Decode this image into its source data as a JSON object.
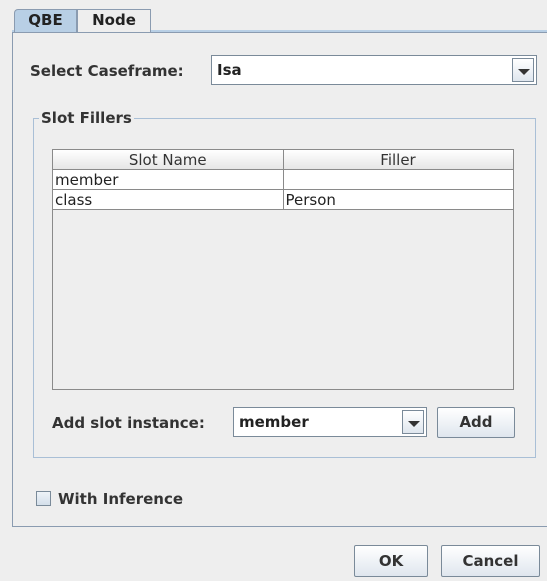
{
  "tabs": [
    {
      "label": "QBE",
      "active": true
    },
    {
      "label": "Node",
      "active": false
    }
  ],
  "caseframe": {
    "label": "Select Caseframe:",
    "selected": "Isa"
  },
  "slot_fillers": {
    "title": "Slot Fillers",
    "columns": [
      "Slot Name",
      "Filler"
    ],
    "rows": [
      {
        "slot": "member",
        "filler": ""
      },
      {
        "slot": "class",
        "filler": "Person"
      }
    ],
    "add_label": "Add slot instance:",
    "add_selected": "member",
    "add_button": "Add"
  },
  "inference": {
    "label": "With Inference",
    "checked": false
  },
  "footer": {
    "ok_label": "OK",
    "cancel_label": "Cancel"
  },
  "colors": {
    "active_tab": "#b8cfe5",
    "background": "#eeeeee",
    "border": "#8a9bb0"
  }
}
